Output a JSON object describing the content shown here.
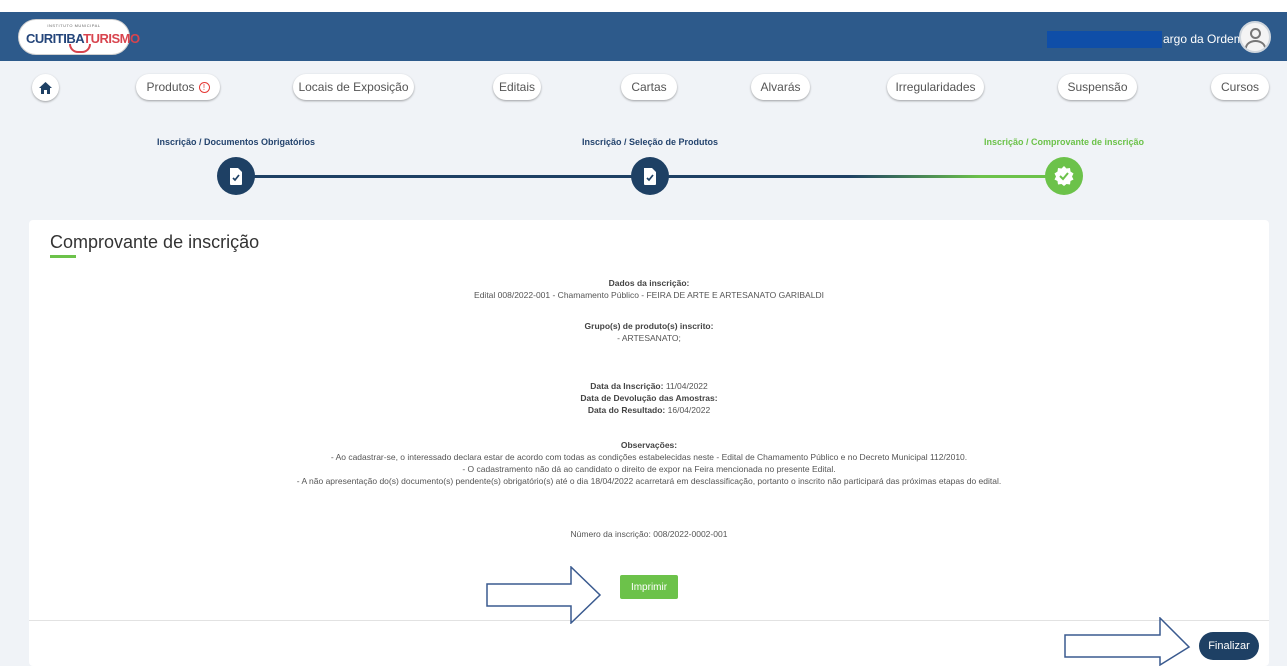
{
  "header": {
    "logo_small": "INSTITUTO MUNICIPAL",
    "logo_part1": "CURITIBA",
    "logo_part2": "TURISMO",
    "user_name": "argo da Ordem",
    "avatar_icon": "user-icon",
    "bar_color": "#2d5a8b"
  },
  "nav": {
    "home_icon": "home-icon",
    "items": [
      {
        "label": "Produtos",
        "has_alert": true
      },
      {
        "label": "Locais de Exposição"
      },
      {
        "label": "Editais"
      },
      {
        "label": "Cartas"
      },
      {
        "label": "Alvarás"
      },
      {
        "label": "Irregularidades"
      },
      {
        "label": "Suspensão"
      },
      {
        "label": "Cursos"
      }
    ]
  },
  "steps": [
    {
      "label": "Inscrição / Documentos Obrigatórios",
      "icon": "document-check-icon",
      "state": "complete"
    },
    {
      "label": "Inscrição / Seleção de Produtos",
      "icon": "document-check-icon",
      "state": "complete"
    },
    {
      "label": "Inscrição / Comprovante de inscrição",
      "icon": "badge-check-icon",
      "state": "active"
    }
  ],
  "colors": {
    "accent_green": "#6cc24a",
    "dark_blue": "#1e4064"
  },
  "receipt": {
    "title": "Comprovante de inscrição",
    "dados_label": "Dados da inscrição:",
    "edital": "Edital 008/2022-001 - Chamamento Público - FEIRA DE ARTE E ARTESANATO GARIBALDI",
    "grupo_label": "Grupo(s) de produto(s) inscrito:",
    "grupo_value": "- ARTESANATO;",
    "data_inscricao_label": "Data da Inscrição:",
    "data_inscricao_value": "11/04/2022",
    "data_devolucao_label": "Data de Devolução das Amostras:",
    "data_resultado_label": "Data do Resultado:",
    "data_resultado_value": "16/04/2022",
    "observacoes_label": "Observações:",
    "obs1": "- Ao cadastrar-se, o interessado declara estar de acordo com todas as condições estabelecidas neste - Edital de Chamamento Público e no Decreto Municipal 112/2010.",
    "obs2": "- O cadastramento não dá ao candidato o direito de expor na Feira mencionada no presente Edital.",
    "obs3": "- A não apresentação do(s) documento(s) pendente(s) obrigatório(s) até o dia 18/04/2022 acarretará em desclassificação, portanto o inscrito não participará das próximas etapas do edital.",
    "numero": "Número da inscrição: 008/2022-0002-001",
    "print_label": "Imprimir"
  },
  "footer": {
    "finalize_label": "Finalizar"
  }
}
